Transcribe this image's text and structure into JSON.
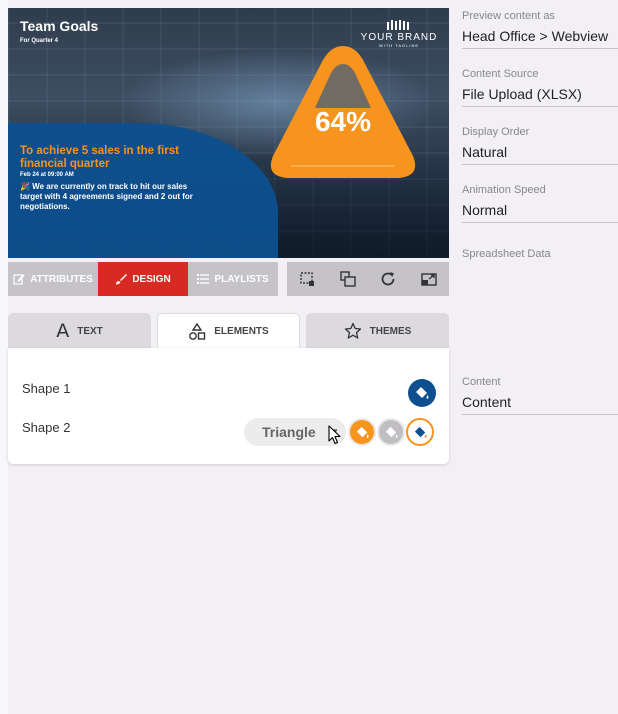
{
  "preview": {
    "title": "Team Goals",
    "subtitle": "For Quarter 4",
    "brand_name": "YOUR BRAND",
    "brand_tagline": "WITH TAGLINE",
    "percent": "64%",
    "goal_heading": "To achieve 5 sales in the first financial quarter",
    "goal_date": "Feb 24 at 09:00 AM",
    "goal_text": "🎉 We are currently on track to hit our sales target with 4 agreements signed and 2 out for negotiations."
  },
  "toolbar": {
    "tabs": [
      {
        "label": "ATTRIBUTES",
        "icon": "edit-icon"
      },
      {
        "label": "DESIGN",
        "icon": "brush-icon",
        "active": true
      },
      {
        "label": "PLAYLISTS",
        "icon": "list-icon"
      }
    ],
    "icons": [
      "crop-icon",
      "layers-icon",
      "refresh-icon",
      "resize-icon"
    ]
  },
  "subtabs": {
    "text": "TEXT",
    "elements": "ELEMENTS",
    "themes": "THEMES"
  },
  "elements": {
    "shape1_label": "Shape 1",
    "shape2_label": "Shape 2",
    "shape2_type": "Triangle",
    "colors": {
      "navy": "#0d4f8f",
      "orange": "#f7941d",
      "grey": "#c0bec2"
    }
  },
  "settings": {
    "preview_label": "Preview content as",
    "preview_value": "Head Office > Webview",
    "source_label": "Content Source",
    "source_value": "File Upload (XLSX)",
    "order_label": "Display Order",
    "order_value": "Natural",
    "speed_label": "Animation Speed",
    "speed_value": "Normal",
    "spreadsheet_label": "Spreadsheet Data",
    "content_label": "Content",
    "content_value": "Content"
  }
}
